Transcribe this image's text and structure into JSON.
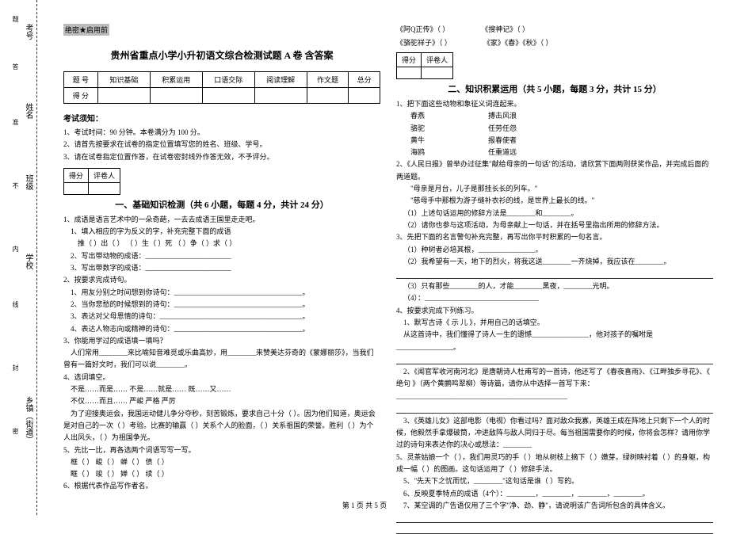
{
  "side": {
    "l1": "考号",
    "l2": "姓名",
    "l3": "班级",
    "l4": "学校",
    "l5": "乡镇（街道）",
    "s1": "题",
    "s2": "答",
    "s3": "准",
    "s4": "不",
    "s5": "内",
    "s6": "线",
    "s7": "封",
    "s8": "密"
  },
  "header": {
    "secret": "绝密★启用前",
    "title": "贵州省重点小学小升初语文综合检测试题 A 卷  含答案"
  },
  "score": {
    "h1": "题    号",
    "h2": "知识基础",
    "h3": "积累运用",
    "h4": "口语交际",
    "h5": "阅读理解",
    "h6": "作文题",
    "h7": "总分",
    "r1": "得    分"
  },
  "notice": {
    "head": "考试须知：",
    "n1": "1、考试时间：90 分钟。本卷满分为 100 分。",
    "n2": "2、请首先按要求在试卷的指定位置填写您的姓名、班级、学号。",
    "n3": "3、请在试卷指定位置作答，在试卷密封线外作答无效，不予评分。"
  },
  "smallscore": {
    "c1": "得分",
    "c2": "评卷人"
  },
  "sec1": {
    "title": "一、基础知识检测（共 6 小题，每题 4 分，共计 24 分）",
    "q1": "1、成语是语言艺术中的一朵奇葩，一去去成语王国里走走吧。",
    "q1a": "1、填入相应的字为反义的字，补充完整下面的成语",
    "q1a1": "推（    ）出（    ）    （    ）生（    ）死    （    ）争（    ）求（    ）",
    "q1b": "2、写出带动物的成语：________________________",
    "q1c": "3、写出带数字的成语：________________________",
    "q2": "2、按要求完成诗句。",
    "q2a": "1、用友分别之时间想到你诗句：____________________________________。",
    "q2b": "2、当你悲愁的时候想到的诗句：____________________________________。",
    "q2c": "3、表达对父母恩情的诗句：________________________________________。",
    "q2d": "4、表达人物志向或精神的诗句：____________________________________。",
    "q3": "3、你能用学过的成语填一填吗？",
    "q3a": "人们常用________来比喻知音难觅或乐曲高妙，用________来赞美达芬奇的《蒙娜丽莎》，当我们曾有一篇好文时，我们可以说________。",
    "q4": "4、选词填空。",
    "q4a": "不是……而是……    不是……就是……    既……又……",
    "q4b": "不仅……而且……    严峻    严格    严厉",
    "q4c": "为了迎接奥运会，我国运动健儿争分夺秒，刻苦锻炼，要求自己十分（    ）。因为他们知道，奥运会是对自己的一次（    ）考验。比赛的输赢（    ）关系个人的脸面，（    ）关系祖国的荣誉。胜利（    ）为个人出风头，（    ）为祖国争光。",
    "q5": "5、先比一比，再各选两个词语写写一写。",
    "q5a": "框（    ）    峻（    ）    蝉（    ）    债（    ）",
    "q5b": "眶（    ）    竣（    ）    婵（    ）    续（    ）",
    "q6": "6、根据代表作品写作者名。"
  },
  "books": {
    "b1": "《阿Q正传》（            ）",
    "b2": "《搜神记》（            ）",
    "b3": "《骆驼祥子》（            ）",
    "b4": "《家》《春》《秋》（            ）"
  },
  "sec2": {
    "title": "二、知识积累运用（共 5 小题，每题 3 分，共计 15 分）",
    "q1": "1、把下面这些动物和象征义词连起来。",
    "left": {
      "a": "春燕",
      "b": "骆驼",
      "c": "黄牛",
      "d": "海鸥"
    },
    "right": {
      "a": "搏击风浪",
      "b": "任劳任怨",
      "c": "报春使者",
      "d": "任重道远"
    },
    "q2": "2、《人民日报》曾举办过征集\"献给母亲的一句话\"的活动，请欣赏下面两则获奖作品，并完成后面的两道题。",
    "q2a": "\"母亲是月台，儿子是那挂长长的列车。\"",
    "q2b": "\"慈母手中那根为游子缝补衣衫的线，是世界上最长的线。\"",
    "q2c": "（1）上述句话运用的修辞方法是________和________。",
    "q2d": "（2）请你也参与这项活动，为母亲献上一句话，并在括号里指出所用的修辞方法。",
    "q3": "3、先把下面的名言警句补充完整，再写出你平时积累的一句名言。",
    "q3a": "（1）种树者必培其根，________________。",
    "q3b": "（2）我希望有一天，地下的烈火，将我这送________一齐烧掉，我应该在________。",
    "q3c": "（3）只有那些________的人，才能________黑夜，________光明。",
    "q3d": "（4）：________________________________",
    "q4": "4、按要求完成下列练习。",
    "q4a": "1、默写古诗《 示 儿 》，并用自己的话填空。",
    "q4b": "从这首诗中，我们懂得了诗人一生的遗憾________________，他对孩子的嘱咐是________________。",
    "q4c": "2、《闻官军收河南河北》是唐朝诗人杜甫写的一首诗，他还写了《春夜喜雨》、《江畔独步寻花》、《    绝句    》（两个黄鹂鸣翠柳）等诗篇，请你从中选择一首写下来：________________________________________________",
    "q4d": "3、《英雄儿女》这部电影（电视）你看过吗？面对敌众我寡，英雄王成在阵地上只剩下一个人的时候，他毅然手拿爆破筒，冲进敌阵与敌人同归于尽。每当祖国需要你的时候，你将会怎样？请用你学过的诗句来表达你的决心或想法：________",
    "q5": "5、灵茶姑娘一个（    ），我们用灵巧的手（    ）地从树枝上摘下（    ）嫩芽。绿树映衬着（    ）的身躯，构成一幅（    ）的图画。这句话运用了（    ）修辞手法。",
    "q5a": "5、\"先天下之忧而忧，________\"这句话是谁（    ）写的。",
    "q5b": "6、反映夏季特点的成语（4个）：________，________，________，________。",
    "q5c": "7、某空调的广告语仅用了三个字\"净、劲、静\"，请说明该广告词所包含的具体含义。"
  },
  "footer": "第 1 页 共 5 页"
}
